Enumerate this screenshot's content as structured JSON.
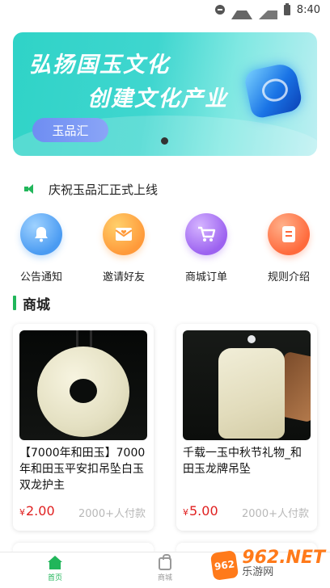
{
  "status_bar": {
    "time": "8:40"
  },
  "banner": {
    "line1": "弘扬国玉文化",
    "line2": "创建文化产业",
    "brand": "玉品汇",
    "page_index": 1,
    "page_count": 1
  },
  "notice": {
    "text": "庆祝玉品汇正式上线"
  },
  "menu": [
    {
      "label": "公告通知",
      "icon": "bell-icon",
      "color": "#4a9bf2"
    },
    {
      "label": "邀请好友",
      "icon": "envelope-icon",
      "color": "#ff9a3a"
    },
    {
      "label": "商城订单",
      "icon": "cart-icon",
      "color": "#9c62f0"
    },
    {
      "label": "规则介绍",
      "icon": "document-icon",
      "color": "#ff6a3c"
    }
  ],
  "section": {
    "title": "商城"
  },
  "products": [
    {
      "title": "【7000年和田玉】7000年和田玉平安扣吊坠白玉双龙护主",
      "currency": "¥",
      "price": "2.00",
      "paid": "2000+人付款"
    },
    {
      "title": "千载一玉中秋节礼物_和田玉龙牌吊坠",
      "currency": "¥",
      "price": "5.00",
      "paid": "2000+人付款"
    }
  ],
  "tabbar": {
    "tabs": [
      {
        "label": "首页",
        "active": true
      },
      {
        "label": "商城",
        "active": false
      }
    ]
  },
  "watermark": {
    "badge": "962",
    "number": "962.NET",
    "sub": "乐游网"
  },
  "colors": {
    "accent": "#21b65a",
    "price": "#e02020"
  }
}
